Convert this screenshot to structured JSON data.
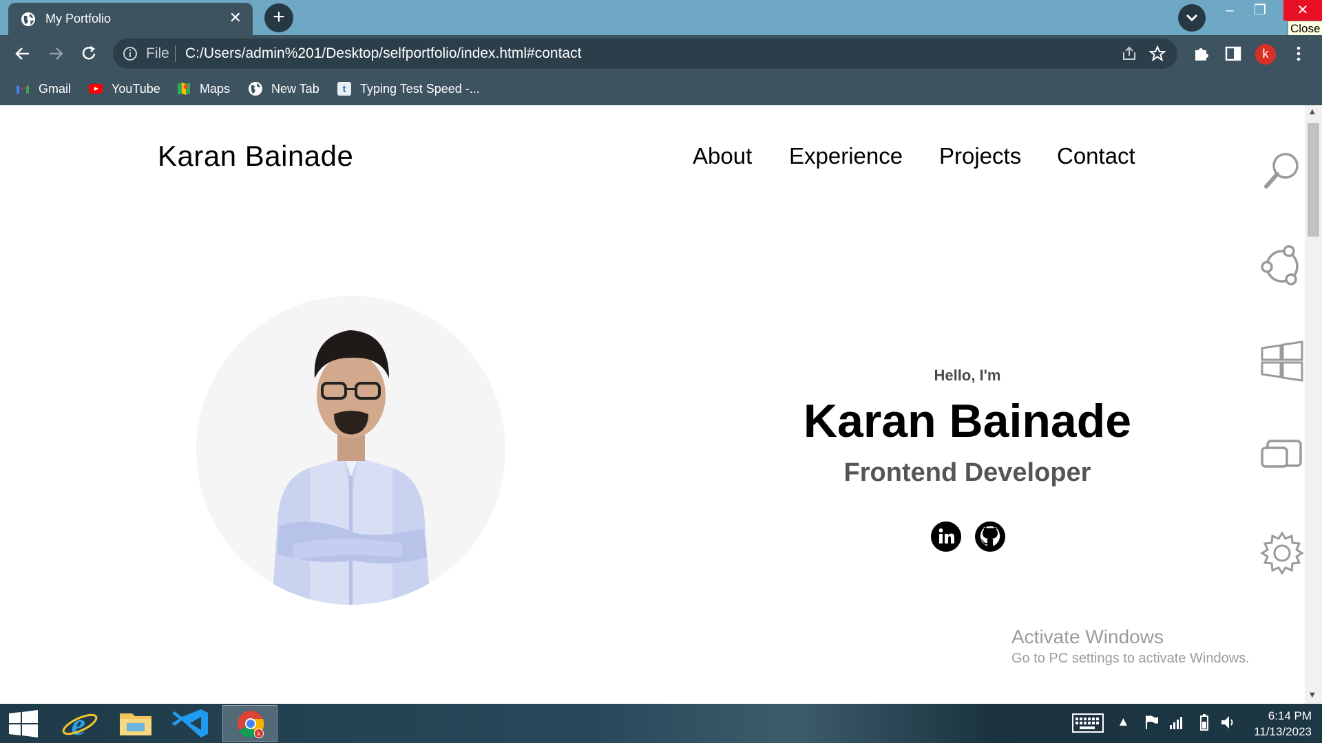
{
  "browser": {
    "tab_title": "My Portfolio",
    "new_tab_symbol": "+",
    "close_tooltip": "Close",
    "address_prefix": "File",
    "url": "C:/Users/admin%201/Desktop/selfportfolio/index.html#contact",
    "profile_initial": "k",
    "bookmarks": [
      {
        "label": "Gmail",
        "icon": "gmail-icon"
      },
      {
        "label": "YouTube",
        "icon": "youtube-icon"
      },
      {
        "label": "Maps",
        "icon": "maps-icon"
      },
      {
        "label": "New Tab",
        "icon": "globe-icon"
      },
      {
        "label": "Typing Test Speed -...",
        "icon": "typing-test-icon"
      }
    ]
  },
  "page": {
    "logo": "Karan Bainade",
    "nav": [
      "About",
      "Experience",
      "Projects",
      "Contact"
    ],
    "hero": {
      "greeting": "Hello, I'm",
      "name": "Karan Bainade",
      "role": "Frontend Developer",
      "social": [
        "linkedin-icon",
        "github-icon"
      ]
    }
  },
  "charms": [
    "search-icon",
    "share-icon",
    "start-icon",
    "devices-icon",
    "settings-icon"
  ],
  "watermark": {
    "title": "Activate Windows",
    "subtitle": "Go to PC settings to activate Windows."
  },
  "taskbar": {
    "apps": [
      "start-icon",
      "internet-explorer-icon",
      "file-explorer-icon",
      "vscode-icon",
      "chrome-icon"
    ],
    "time": "6:14 PM",
    "date": "11/13/2023"
  },
  "colors": {
    "tabbar": "#6fa8c4",
    "chrome": "#3d5360",
    "close_red": "#e81123"
  }
}
